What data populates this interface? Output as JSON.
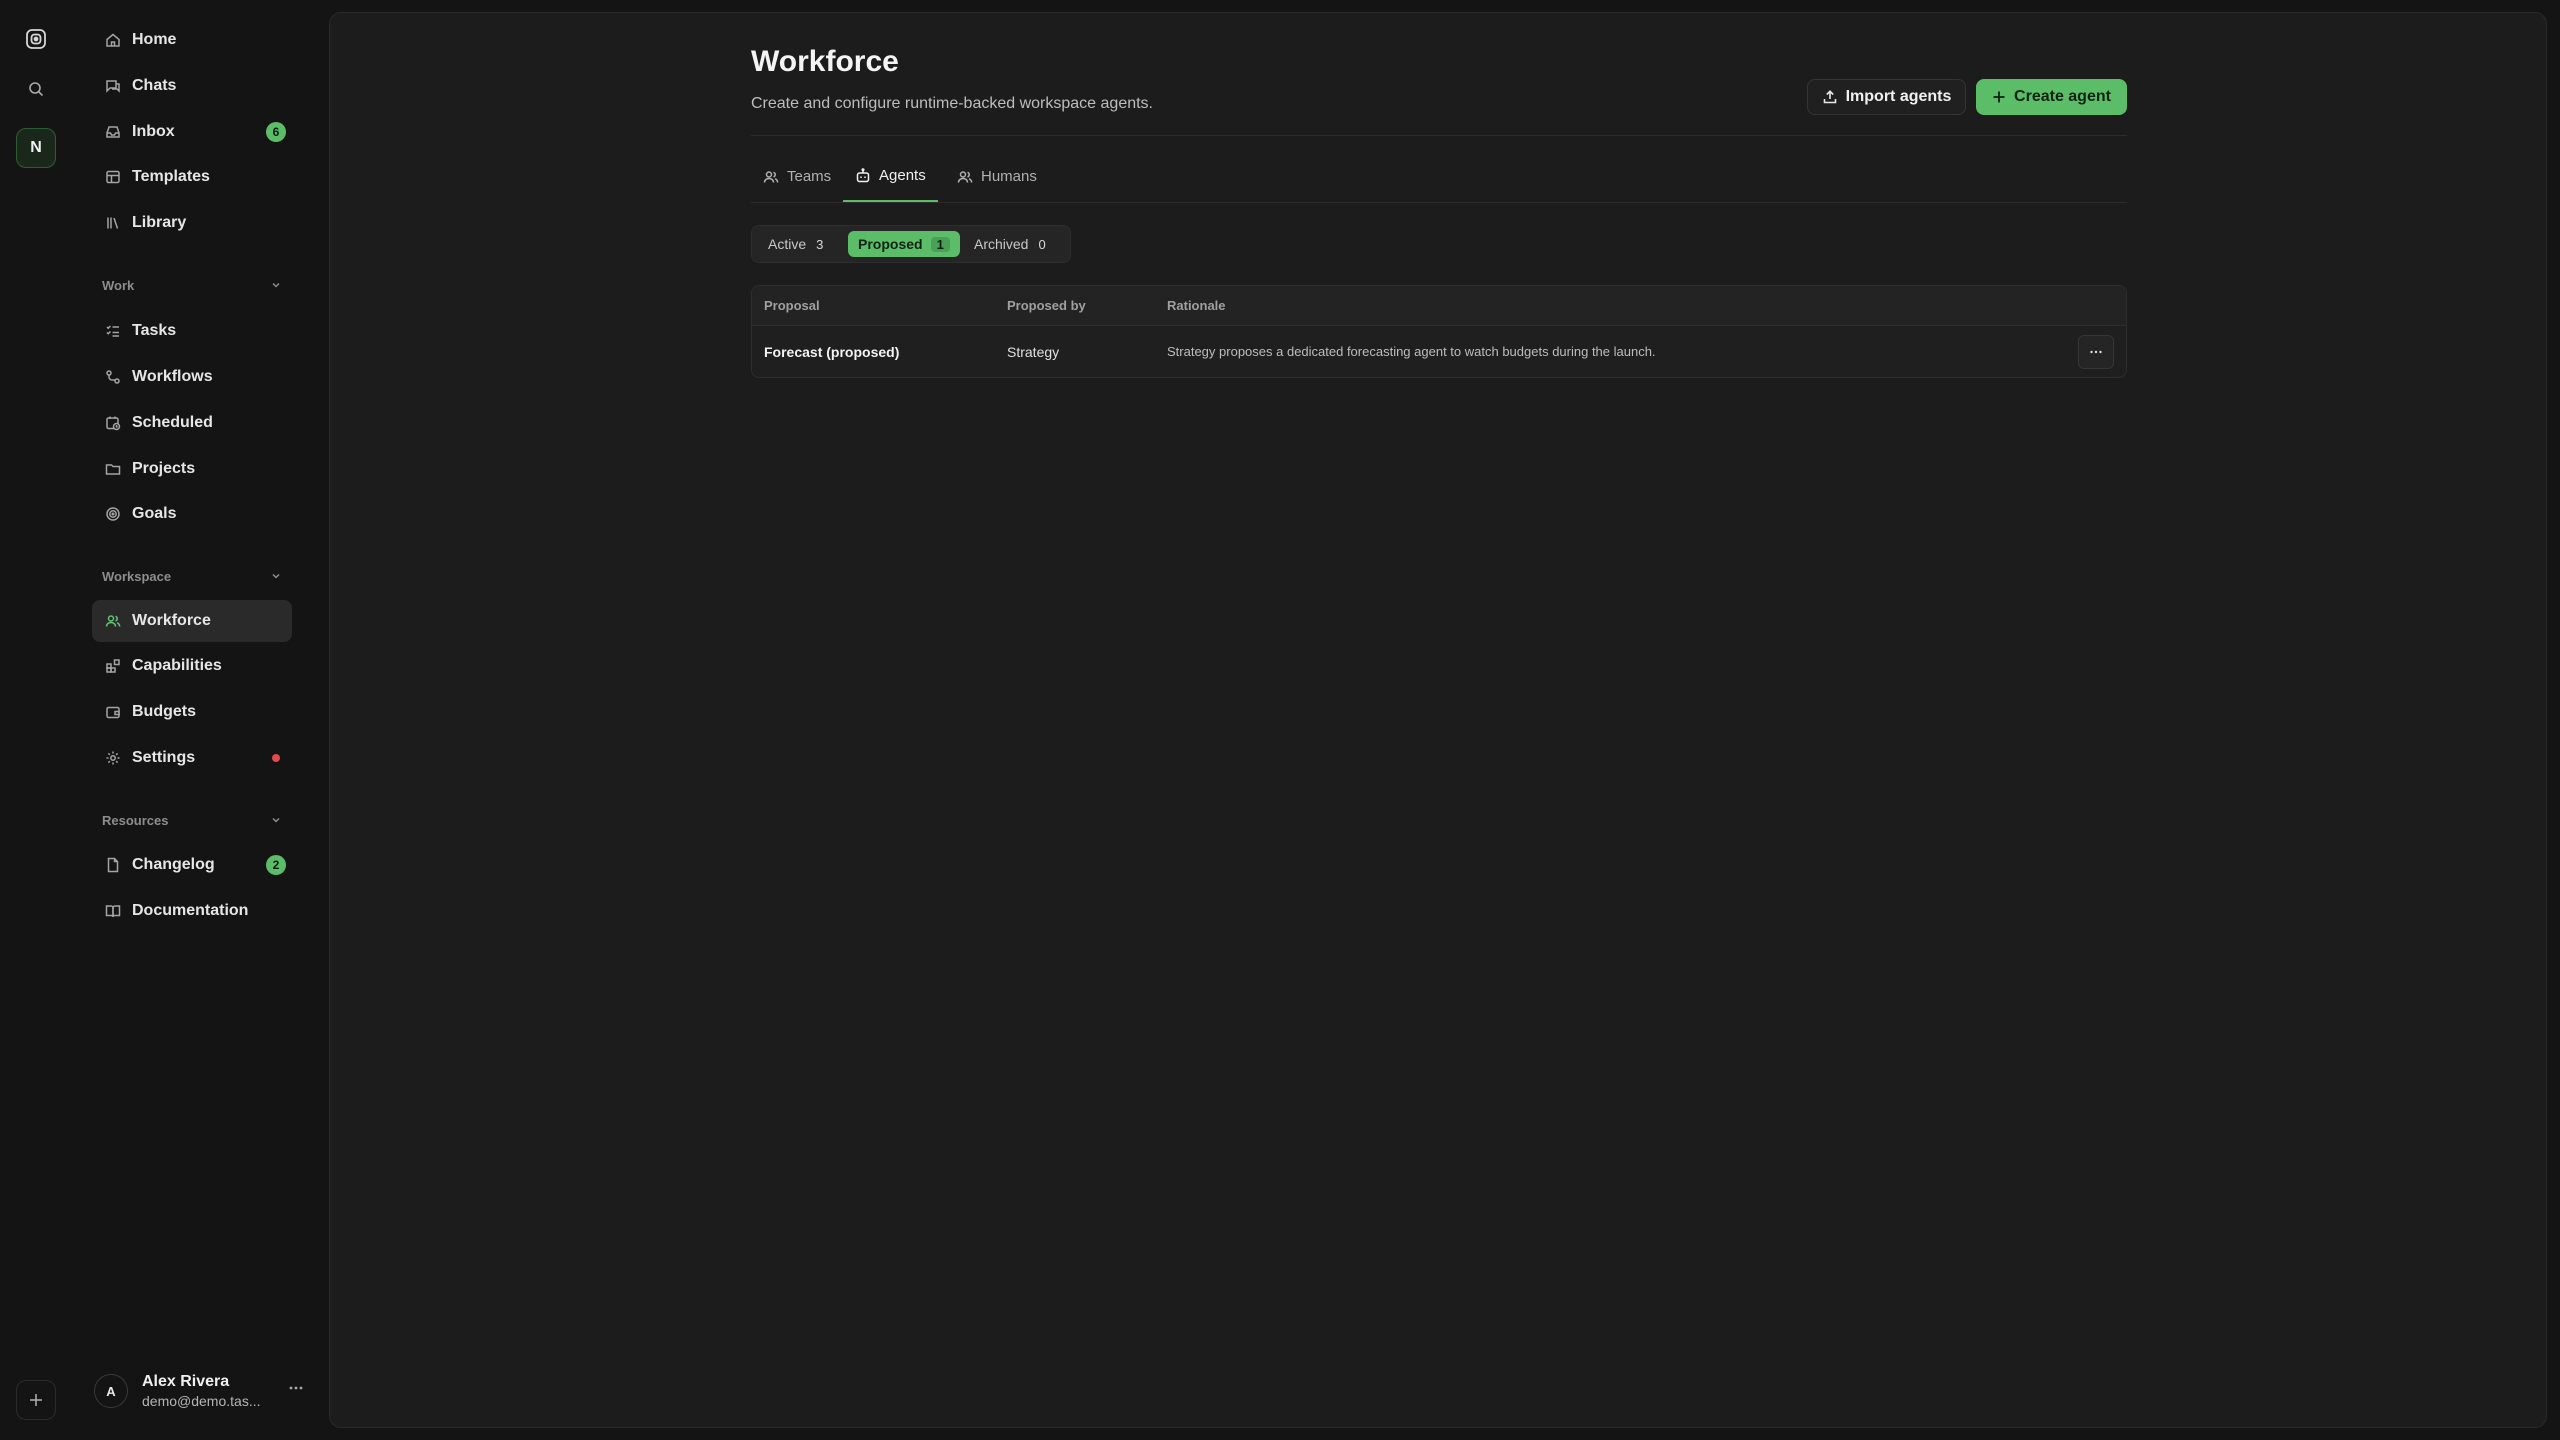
{
  "rail": {
    "workspace_initial": "N"
  },
  "sidebar": {
    "top_items": [
      {
        "label": "Home"
      },
      {
        "label": "Chats"
      },
      {
        "label": "Inbox",
        "badge": "6"
      },
      {
        "label": "Templates"
      },
      {
        "label": "Library"
      }
    ],
    "work": {
      "label": "Work",
      "items": [
        {
          "label": "Tasks"
        },
        {
          "label": "Workflows"
        },
        {
          "label": "Scheduled"
        },
        {
          "label": "Projects"
        },
        {
          "label": "Goals"
        }
      ]
    },
    "workspace": {
      "label": "Workspace",
      "items": [
        {
          "label": "Workforce"
        },
        {
          "label": "Capabilities"
        },
        {
          "label": "Budgets"
        },
        {
          "label": "Settings"
        }
      ]
    },
    "resources": {
      "label": "Resources",
      "items": [
        {
          "label": "Changelog",
          "badge": "2"
        },
        {
          "label": "Documentation"
        }
      ]
    },
    "user": {
      "initial": "A",
      "name": "Alex Rivera",
      "email": "demo@demo.tas..."
    }
  },
  "page": {
    "title": "Workforce",
    "subtitle": "Create and configure runtime-backed workspace agents.",
    "import_label": "Import agents",
    "create_label": "Create agent",
    "tabs": [
      {
        "label": "Teams"
      },
      {
        "label": "Agents"
      },
      {
        "label": "Humans"
      }
    ],
    "filters": [
      {
        "label": "Active",
        "count": "3"
      },
      {
        "label": "Proposed",
        "count": "1"
      },
      {
        "label": "Archived",
        "count": "0"
      }
    ],
    "table": {
      "headers": [
        "Proposal",
        "Proposed by",
        "Rationale"
      ],
      "rows": [
        {
          "proposal": "Forecast (proposed)",
          "proposed_by": "Strategy",
          "rationale": "Strategy proposes a dedicated forecasting agent to watch budgets during the launch."
        }
      ]
    }
  },
  "colors": {
    "accent": "#5bbd68",
    "background": "#141414",
    "panel": "#1c1c1c",
    "alert": "#e5484d"
  }
}
